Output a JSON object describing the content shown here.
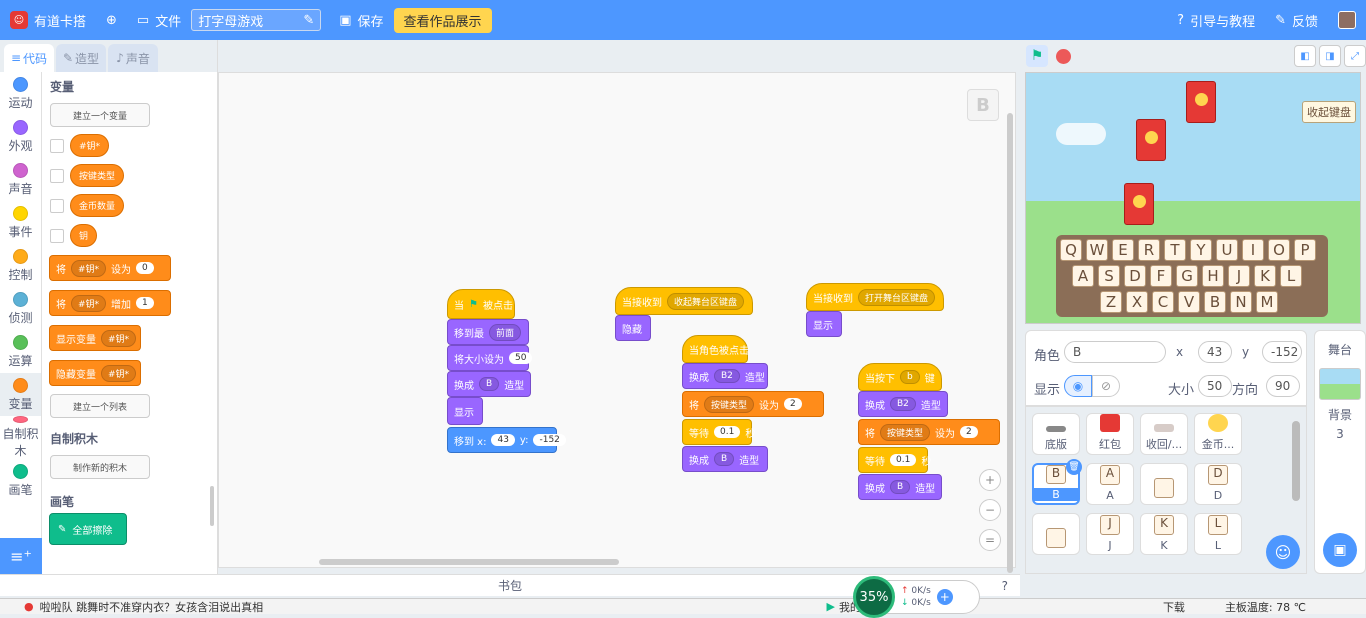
{
  "topbar": {
    "logo_text": "有道卡搭",
    "file_label": "文件",
    "project_name": "打字母游戏",
    "save_label": "保存",
    "works_label": "查看作品展示",
    "guide_label": "引导与教程",
    "feedback_label": "反馈"
  },
  "tabs": {
    "code": "代码",
    "costume": "造型",
    "sound": "声音"
  },
  "categories": [
    "运动",
    "外观",
    "声音",
    "事件",
    "控制",
    "侦测",
    "运算",
    "变量",
    "自制积木",
    "画笔"
  ],
  "category_colors": [
    "#4c97ff",
    "#9966ff",
    "#cf63cf",
    "#ffd500",
    "#ffab19",
    "#5cb1d6",
    "#59c059",
    "#ff8c1a",
    "#ff6680",
    "#0fbd8c"
  ],
  "palette": {
    "variables_heading": "变量",
    "make_variable": "建立一个变量",
    "variables": [
      "#钥*",
      "按键类型",
      "金币数量",
      "钥"
    ],
    "set_block": {
      "prefix": "将",
      "var": "#钥*",
      "op": "设为",
      "value": "0"
    },
    "change_block": {
      "prefix": "将",
      "var": "#钥*",
      "op": "增加",
      "value": "1"
    },
    "show_var": {
      "label": "显示变量",
      "var": "#钥*"
    },
    "hide_var": {
      "label": "隐藏变量",
      "var": "#钥*"
    },
    "make_list": "建立一个列表",
    "myblocks_heading": "自制积木",
    "make_block": "制作新的积木",
    "pen_heading": "画笔",
    "pen_clear": "全部擦除"
  },
  "scripts": {
    "s1": {
      "hat": "当",
      "hat2": "被点击",
      "b1": "移到最",
      "b1v": "前面",
      "b2": "将大小设为",
      "b2v": "50",
      "b3": "换成",
      "b3v": "B",
      "b3s": "造型",
      "b4": "显示",
      "b5": "移到 x:",
      "b5x": "43",
      "b5y_l": "y:",
      "b5y": "-152"
    },
    "s2": {
      "hat": "当接收到",
      "msg": "收起舞台区键盘",
      "b1": "隐藏"
    },
    "s3": {
      "hat": "当角色被点击",
      "b1": "换成",
      "b1v": "B2",
      "b1s": "造型",
      "b2": "将",
      "b2var": "按键类型",
      "b2op": "设为",
      "b2v": "2",
      "b3": "等待",
      "b3v": "0.1",
      "b3s": "秒",
      "b4": "换成",
      "b4v": "B",
      "b4s": "造型"
    },
    "s4": {
      "hat": "当接收到",
      "msg": "打开舞台区键盘",
      "b1": "显示"
    },
    "s5": {
      "hat": "当按下",
      "key": "b",
      "hat2": "键",
      "b1": "换成",
      "b1v": "B2",
      "b1s": "造型",
      "b2": "将",
      "b2var": "按键类型",
      "b2op": "设为",
      "b2v": "2",
      "b3": "等待",
      "b3v": "0.1",
      "b3s": "秒",
      "b4": "换成",
      "b4v": "B",
      "b4s": "造型"
    }
  },
  "workspace": {
    "sprite_badge": "B",
    "zoom_in": "+",
    "zoom_out": "−",
    "zoom_reset": "="
  },
  "stage": {
    "collapse_label": "收起键盘",
    "row1": [
      "Q",
      "W",
      "E",
      "R",
      "T",
      "Y",
      "U",
      "I",
      "O",
      "P"
    ],
    "row2": [
      "A",
      "S",
      "D",
      "F",
      "G",
      "H",
      "J",
      "K",
      "L"
    ],
    "row3": [
      "Z",
      "X",
      "C",
      "V",
      "B",
      "N",
      "M"
    ]
  },
  "sprite_info": {
    "sprite_label": "角色",
    "sprite_name": "B",
    "x_label": "x",
    "x": "43",
    "y_label": "y",
    "y": "-152",
    "show_label": "显示",
    "size_label": "大小",
    "size": "50",
    "dir_label": "方向",
    "dir": "90"
  },
  "sprites": [
    "底版",
    "红包",
    "收回/...",
    "金币...",
    "B",
    "A",
    "",
    "D",
    "",
    "J",
    "K",
    "L"
  ],
  "stage_col": {
    "label": "舞台",
    "bg_label": "背景",
    "bg_count": "3"
  },
  "bottom": {
    "bag_label": "书包"
  },
  "taskbar": {
    "news": "啦啦队 跳舞时不准穿内衣？女孩含泪说出真相",
    "video": "我的视频",
    "pct": "35%",
    "up": "0K/s",
    "down": "0K/s",
    "temp": "主板温度: 78 ℃",
    "download": "下载"
  }
}
